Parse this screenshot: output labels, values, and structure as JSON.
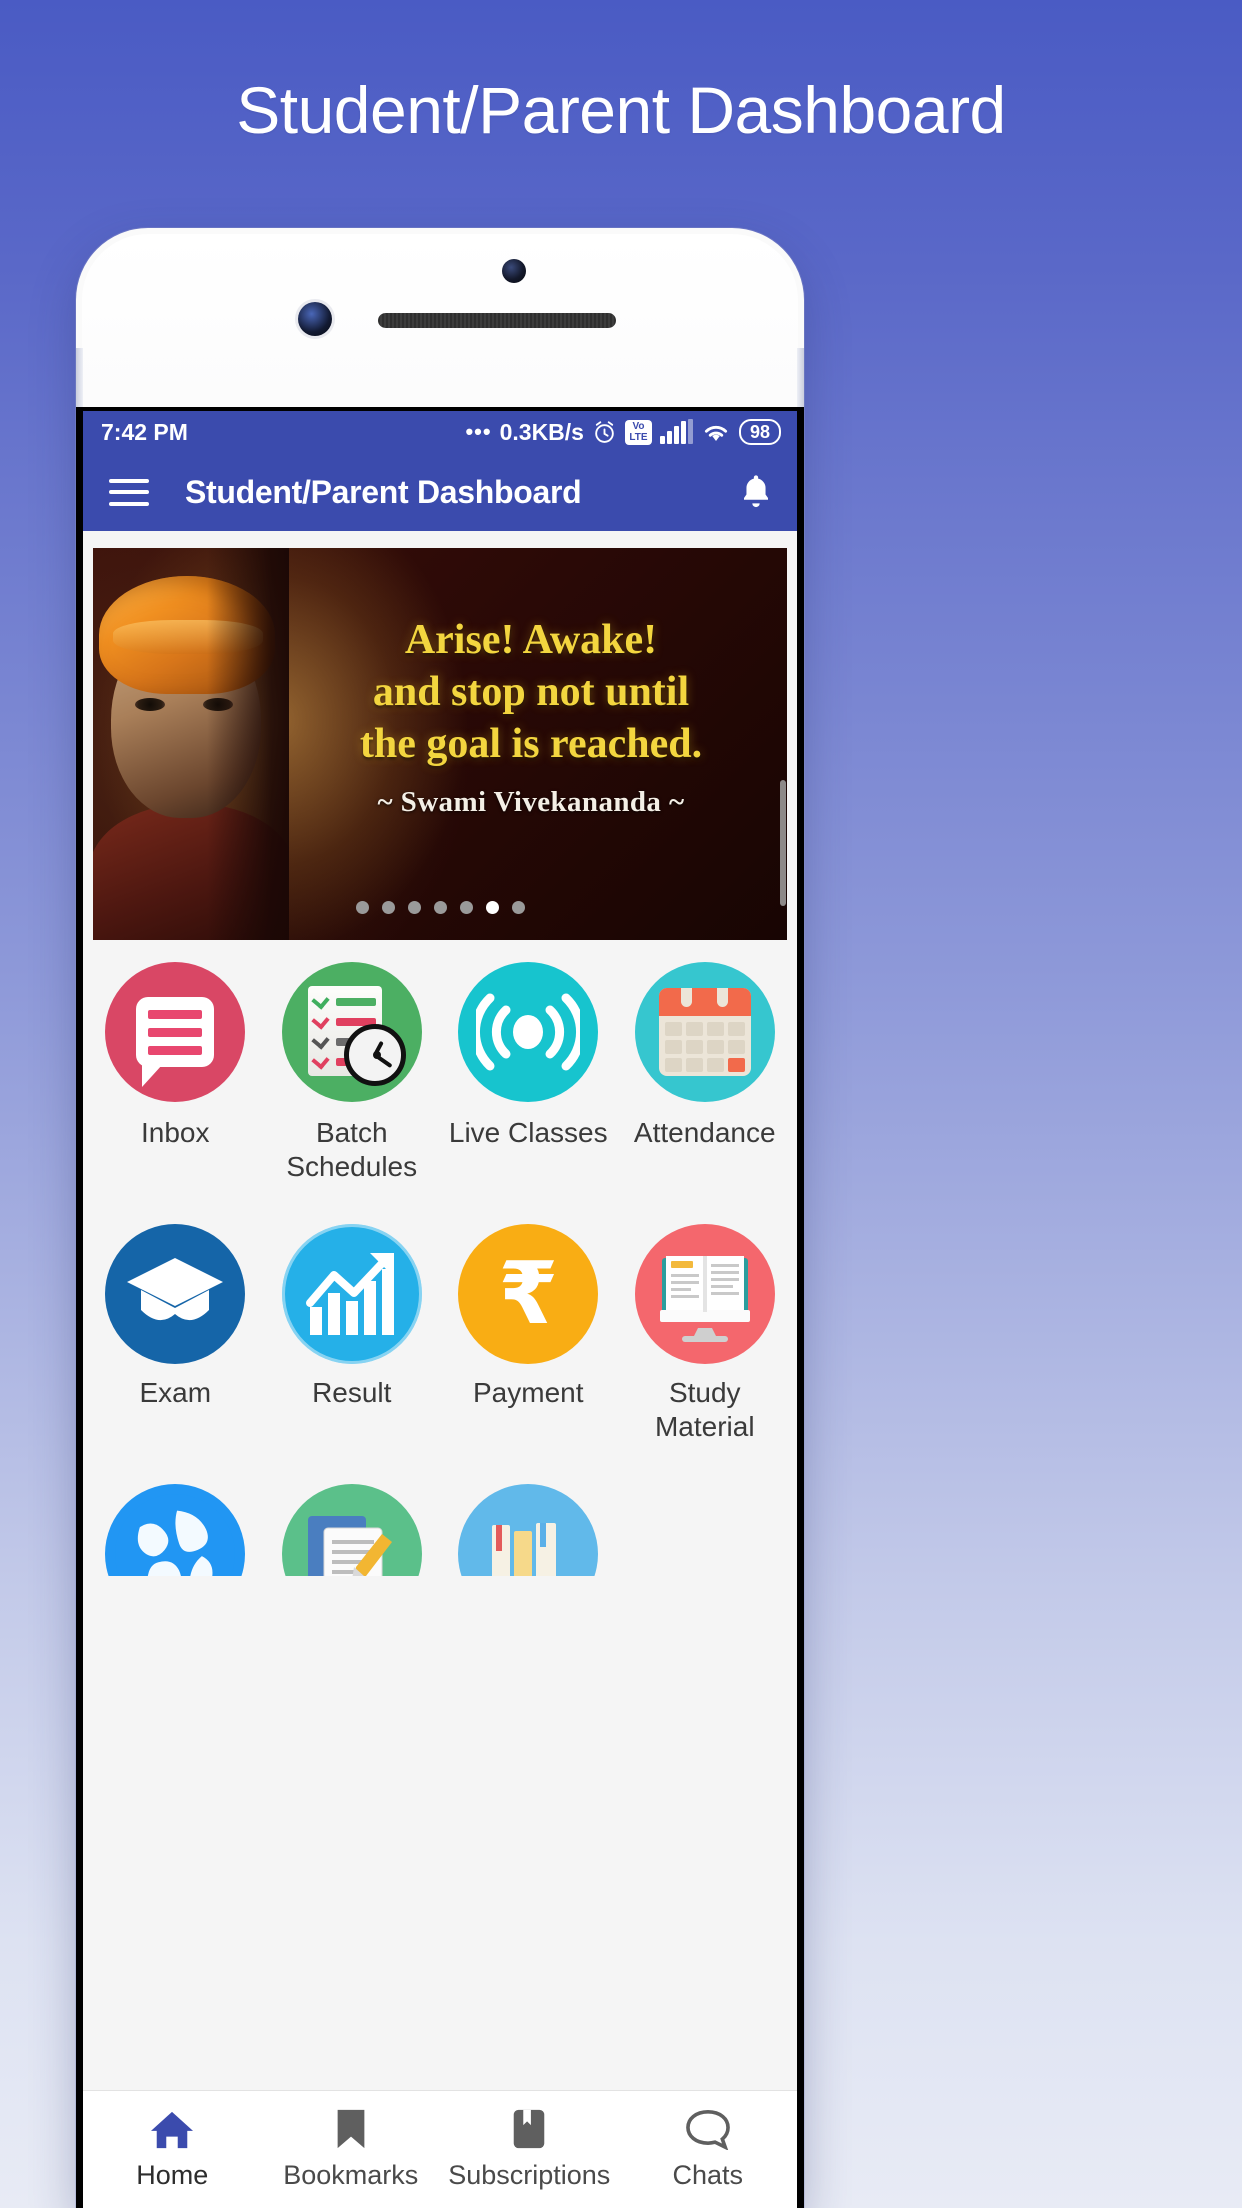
{
  "page": {
    "heading": "Student/Parent Dashboard"
  },
  "statusbar": {
    "time": "7:42 PM",
    "dots": "•••",
    "network_speed": "0.3KB/s",
    "alarm_icon": "alarm-clock-icon",
    "volte_top": "Vo",
    "volte_bottom": "LTE",
    "signal_icon": "cellular-signal-icon",
    "wifi_icon": "wifi-icon",
    "battery_level": "98"
  },
  "appbar": {
    "menu_icon": "hamburger-menu-icon",
    "title": "Student/Parent Dashboard",
    "notification_icon": "bell-icon",
    "background": "#3b4bad"
  },
  "carousel": {
    "quote_line1": "Arise! Awake!",
    "quote_line2": "and stop not until",
    "quote_line3": "the goal is reached.",
    "author": "~ Swami Vivekananda ~",
    "quote_color": "#f3d63f",
    "total_dots": 7,
    "active_dot_index": 5
  },
  "grid": {
    "rows": [
      [
        {
          "label": "Inbox",
          "icon": "inbox-chat-icon",
          "color": "#d94765"
        },
        {
          "label": "Batch\nSchedules",
          "label_line1": "Batch",
          "label_line2": "Schedules",
          "icon": "batch-schedule-icon",
          "color": "#4caf63"
        },
        {
          "label": "Live Classes",
          "icon": "live-broadcast-icon",
          "color": "#17c4ce"
        },
        {
          "label": "Attendance",
          "icon": "calendar-icon",
          "color": "#36c6cf"
        }
      ],
      [
        {
          "label": "Exam",
          "icon": "graduation-cap-icon",
          "color": "#1565a8"
        },
        {
          "label": "Result",
          "icon": "growth-chart-icon",
          "color": "#25b0e8"
        },
        {
          "label": "Payment",
          "icon": "rupee-icon",
          "color": "#f9ad14"
        },
        {
          "label": "Study Material",
          "icon": "study-monitor-icon",
          "color": "#f4676d"
        }
      ],
      [
        {
          "label": "",
          "icon": "globe-icon",
          "color": "#2196f3"
        },
        {
          "label": "",
          "icon": "assignment-docs-icon",
          "color": "#5bc08a"
        },
        {
          "label": "",
          "icon": "books-icon",
          "color": "#61b9ea"
        }
      ]
    ]
  },
  "bottomnav": {
    "items": [
      {
        "label": "Home",
        "icon": "home-icon",
        "active": true
      },
      {
        "label": "Bookmarks",
        "icon": "bookmark-icon",
        "active": false
      },
      {
        "label": "Subscriptions",
        "icon": "subscriptions-book-icon",
        "active": false
      },
      {
        "label": "Chats",
        "icon": "chat-bubble-icon",
        "active": false
      }
    ],
    "active_color": "#3b4bad",
    "inactive_color": "#5f5f5f"
  }
}
